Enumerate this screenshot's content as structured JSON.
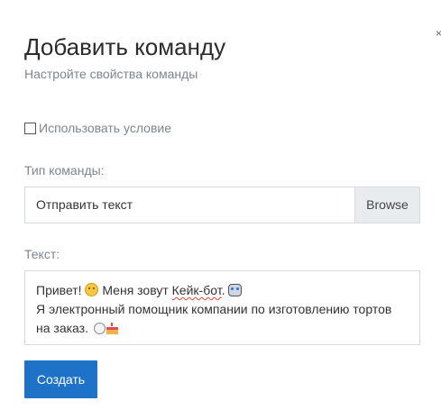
{
  "dialog": {
    "title": "Добавить команду",
    "subtitle": "Настройте свойства команды",
    "close_glyph": "×"
  },
  "condition": {
    "checked": false,
    "label": "Использовать условие"
  },
  "command_type": {
    "label": "Тип команды:",
    "value": "Отправить текст",
    "browse_label": "Browse"
  },
  "text": {
    "label": "Текст:",
    "line1_part1": "Привет!",
    "line1_part2": "Меня зовут",
    "line1_misspelled": "Кейк-бот",
    "line1_part3": ".",
    "line2": "Я электронный помощник компании по изготовлению тортов",
    "line3": "на заказ.",
    "icons": [
      "smiling-face-emoji-icon",
      "robot-emoji-icon",
      "plate-emoji-icon",
      "cake-emoji-icon"
    ]
  },
  "actions": {
    "create_label": "Создать"
  },
  "colors": {
    "primary_button": "#1e73c8",
    "muted_text": "#7d8592",
    "browse_bg": "#e9ecef"
  }
}
